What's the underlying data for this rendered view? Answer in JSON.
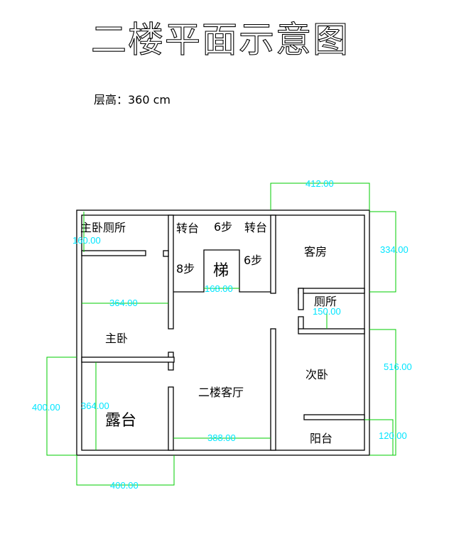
{
  "title": "二楼平面示意图",
  "floor_height_label": "层高：360 cm",
  "rooms": {
    "master_toilet": "主卧厕所",
    "landing_left": "转台",
    "steps_top": "6步",
    "landing_right": "转台",
    "steps_left": "8步",
    "stair": "梯",
    "steps_right": "6步",
    "guest_room": "客房",
    "toilet": "厕所",
    "master_bedroom": "主卧",
    "second_bedroom": "次卧",
    "living_room": "二楼客厅",
    "terrace": "露台",
    "balcony": "阳台"
  },
  "dimensions": {
    "d_412": "412.00",
    "d_334": "334.00",
    "d_160": "160.00",
    "d_364_a": "364.00",
    "d_168": "168.00",
    "d_150": "150.00",
    "d_516": "516.00",
    "d_400_left": "400.00",
    "d_364_b": "364.00",
    "d_388": "388.00",
    "d_120": "120.00",
    "d_400_bottom": "400.00"
  },
  "colors": {
    "walls": "#000000",
    "dimension_lines": "#00cc00",
    "dimension_text": "#00e5ff"
  }
}
